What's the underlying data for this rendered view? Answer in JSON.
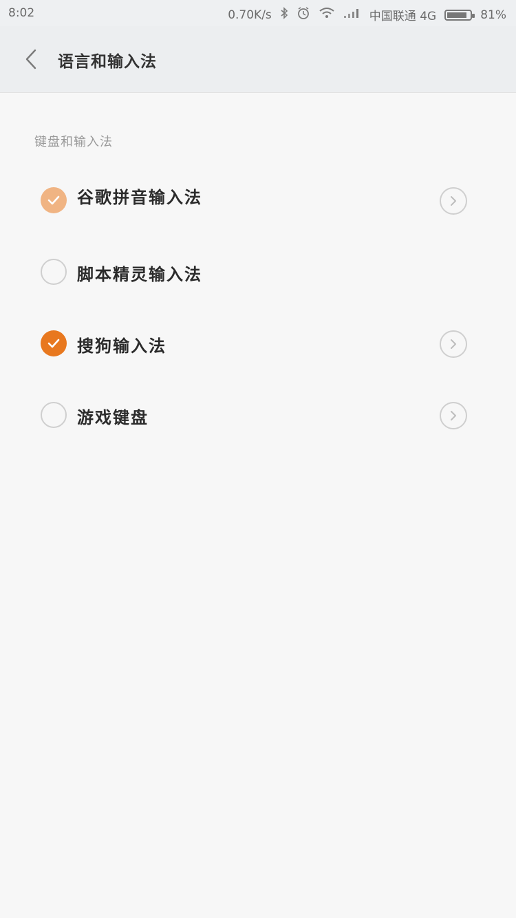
{
  "status_bar": {
    "time": "8:02",
    "speed": "0.70K/s",
    "bluetooth_icon": "bluetooth-icon",
    "alarm_icon": "alarm-icon",
    "wifi_icon": "wifi-icon",
    "signal_icon": "signal-icon",
    "carrier": "中国联通 4G",
    "battery": "81%"
  },
  "header": {
    "title": "语言和输入法",
    "back_icon": "back-arrow-icon"
  },
  "section": {
    "label": "键盘和输入法"
  },
  "input_methods": [
    {
      "label": "谷歌拼音输入法",
      "sublabel": "",
      "checked": true,
      "faded": true,
      "has_settings": true
    },
    {
      "label": "脚本精灵输入法",
      "checked": false,
      "faded": false,
      "has_settings": false
    },
    {
      "label": "搜狗输入法",
      "checked": true,
      "faded": false,
      "has_settings": true
    },
    {
      "label": "游戏键盘",
      "checked": false,
      "faded": false,
      "has_settings": true
    }
  ],
  "colors": {
    "accent": "#e8781f",
    "accent_faded": "#f0b483",
    "background": "#f7f7f7",
    "header_bg": "#eceef0"
  }
}
